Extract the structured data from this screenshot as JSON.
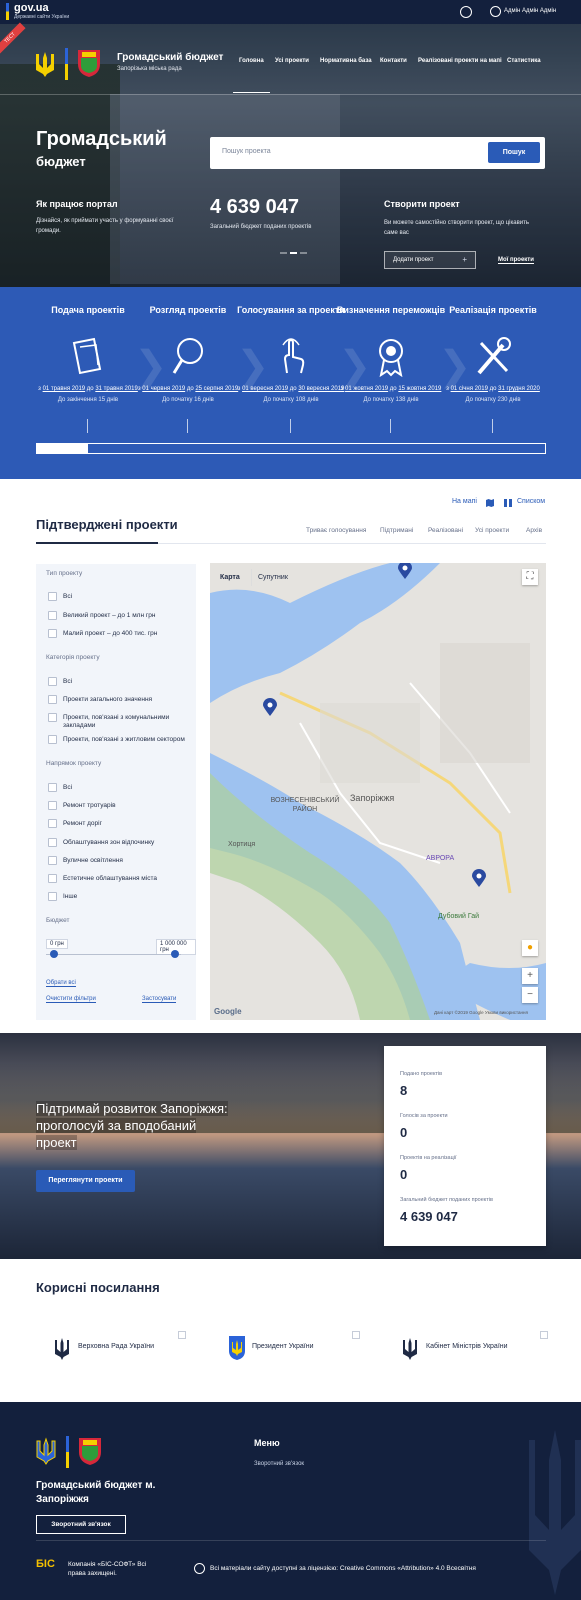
{
  "topbar": {
    "gov": "gov.ua",
    "gov_sub": "Державні сайти України",
    "user_name": "Адмін Адмін Адмін"
  },
  "hero": {
    "stamp": "ТЕСТ",
    "brand_title": "Громадський бюджет",
    "brand_sub": "Запорізька міська рада",
    "nav": [
      "Головна",
      "Усі проекти",
      "Нормативна база",
      "Контакти",
      "Реалізовані проекти на мапі",
      "Статистика"
    ],
    "title": "Громадський",
    "title2": "бюджет",
    "search_placeholder": "Пошук проекта",
    "search_button": "Пошук",
    "how_title": "Як працює портал",
    "how_desc": "Дізнайся, як приймати участь у формуванні своєї громади.",
    "budget_value": "4 639 047",
    "budget_desc": "Загальний бюджет поданих проектів",
    "create_title": "Створити проект",
    "create_desc": "Ви можете самостійно створити проект, що цікавить саме вас",
    "add_button": "Додати проект",
    "add_plus": "+",
    "my_projects": "Мої проекти"
  },
  "stages": [
    {
      "title": "Подача проектів",
      "from": "01 травня 2019",
      "to": "31 травня 2019",
      "left": "До закінчення 15 днів"
    },
    {
      "title": "Розгляд проектів",
      "from": "01 червня 2019",
      "to": "25 серпня 2019",
      "left": "До початку 16 днів"
    },
    {
      "title": "Голосування за проекти",
      "from": "01 вересня 2019",
      "to": "30 вересня 2019",
      "left": "До початку 108 днів"
    },
    {
      "title": "Визначення переможців",
      "from": "01 жовтня 2019",
      "to": "15 жовтня 2019",
      "left": "До початку 138 днів"
    },
    {
      "title": "Реалізація проектів",
      "from": "01 січня 2019",
      "to": "31 грудня 2020",
      "left": "До початку 230 днів"
    }
  ],
  "stage_words": {
    "from": "з",
    "to": "до"
  },
  "progress": {
    "fraction": 0.1
  },
  "confirmed": {
    "view_map": "На мапі",
    "view_list": "Списком",
    "title": "Підтверджені проекти",
    "tabs": [
      "Триває голосування",
      "Підтримані",
      "Реалізовані",
      "Усі проекти",
      "Архів"
    ]
  },
  "filters": {
    "type_title": "Тип проекту",
    "type_items": [
      "Всі",
      "Великий проект – до 1 млн грн",
      "Малий проект – до 400 тис. грн"
    ],
    "category_title": "Категорія проекту",
    "category_items": [
      "Всі",
      "Проекти загального значення",
      "Проекти, пов'язані з комунальними закладами",
      "Проекти, пов'язані з житловим сектором"
    ],
    "direction_title": "Напрямок проекту",
    "direction_items": [
      "Всі",
      "Ремонт тротуарів",
      "Ремонт доріг",
      "Облаштування зон відпочинку",
      "Вуличне освітлення",
      "Естетичне облаштування міста",
      "Інше"
    ],
    "budget_title": "Бюджет",
    "budget_min": "0 грн",
    "budget_max": "1 000 000 грн",
    "choose_all": "Обрати всі",
    "clear": "Очистити фільтри",
    "apply": "Застосувати"
  },
  "map": {
    "tab_map": "Карта",
    "tab_satellite": "Супутник",
    "city": "Запоріжжя",
    "district": "ВОЗНЕСЕНІВСЬКИЙ РАЙОН",
    "khortytsia": "Хортиця",
    "google": "Google",
    "attribution": "Дані карт ©2019 Google    Умови використання",
    "zoom_in": "+",
    "zoom_out": "−",
    "avrora": "АВРОРА",
    "dubovyi_hai": "Дубовий Гай"
  },
  "banner": {
    "text": "Підтримай розвиток Запоріжжя: проголосуй за вподобаний проект",
    "button": "Переглянути проекти"
  },
  "stats": [
    {
      "label": "Подано проектів",
      "value": "8"
    },
    {
      "label": "Голосів за проекти",
      "value": "0"
    },
    {
      "label": "Проектів на реалізації",
      "value": "0"
    },
    {
      "label": "Загальний бюджет поданих проектів",
      "value": "4 639 047"
    }
  ],
  "links": {
    "title": "Корисні посилання",
    "items": [
      "Верховна Рада України",
      "Президент України",
      "Кабінет Міністрів України"
    ]
  },
  "footer": {
    "menu": "Меню",
    "feedback_link": "Зворотний зв'язок",
    "title": "Громадський бюджет м. Запоріжжя",
    "feedback_button": "Зворотний зв'язок",
    "bis": "БІС",
    "company": "Компанія «БІС-СОФТ» Всі права захищені.",
    "cc": "cc",
    "license": "Всі матеріали сайту доступні за ліцензією: Creative Commons «Attribution» 4.0 Всесвітня"
  },
  "colors": {
    "primary": "#2d5ab6",
    "navy": "#13203d",
    "accent_yellow": "#f5d000"
  }
}
